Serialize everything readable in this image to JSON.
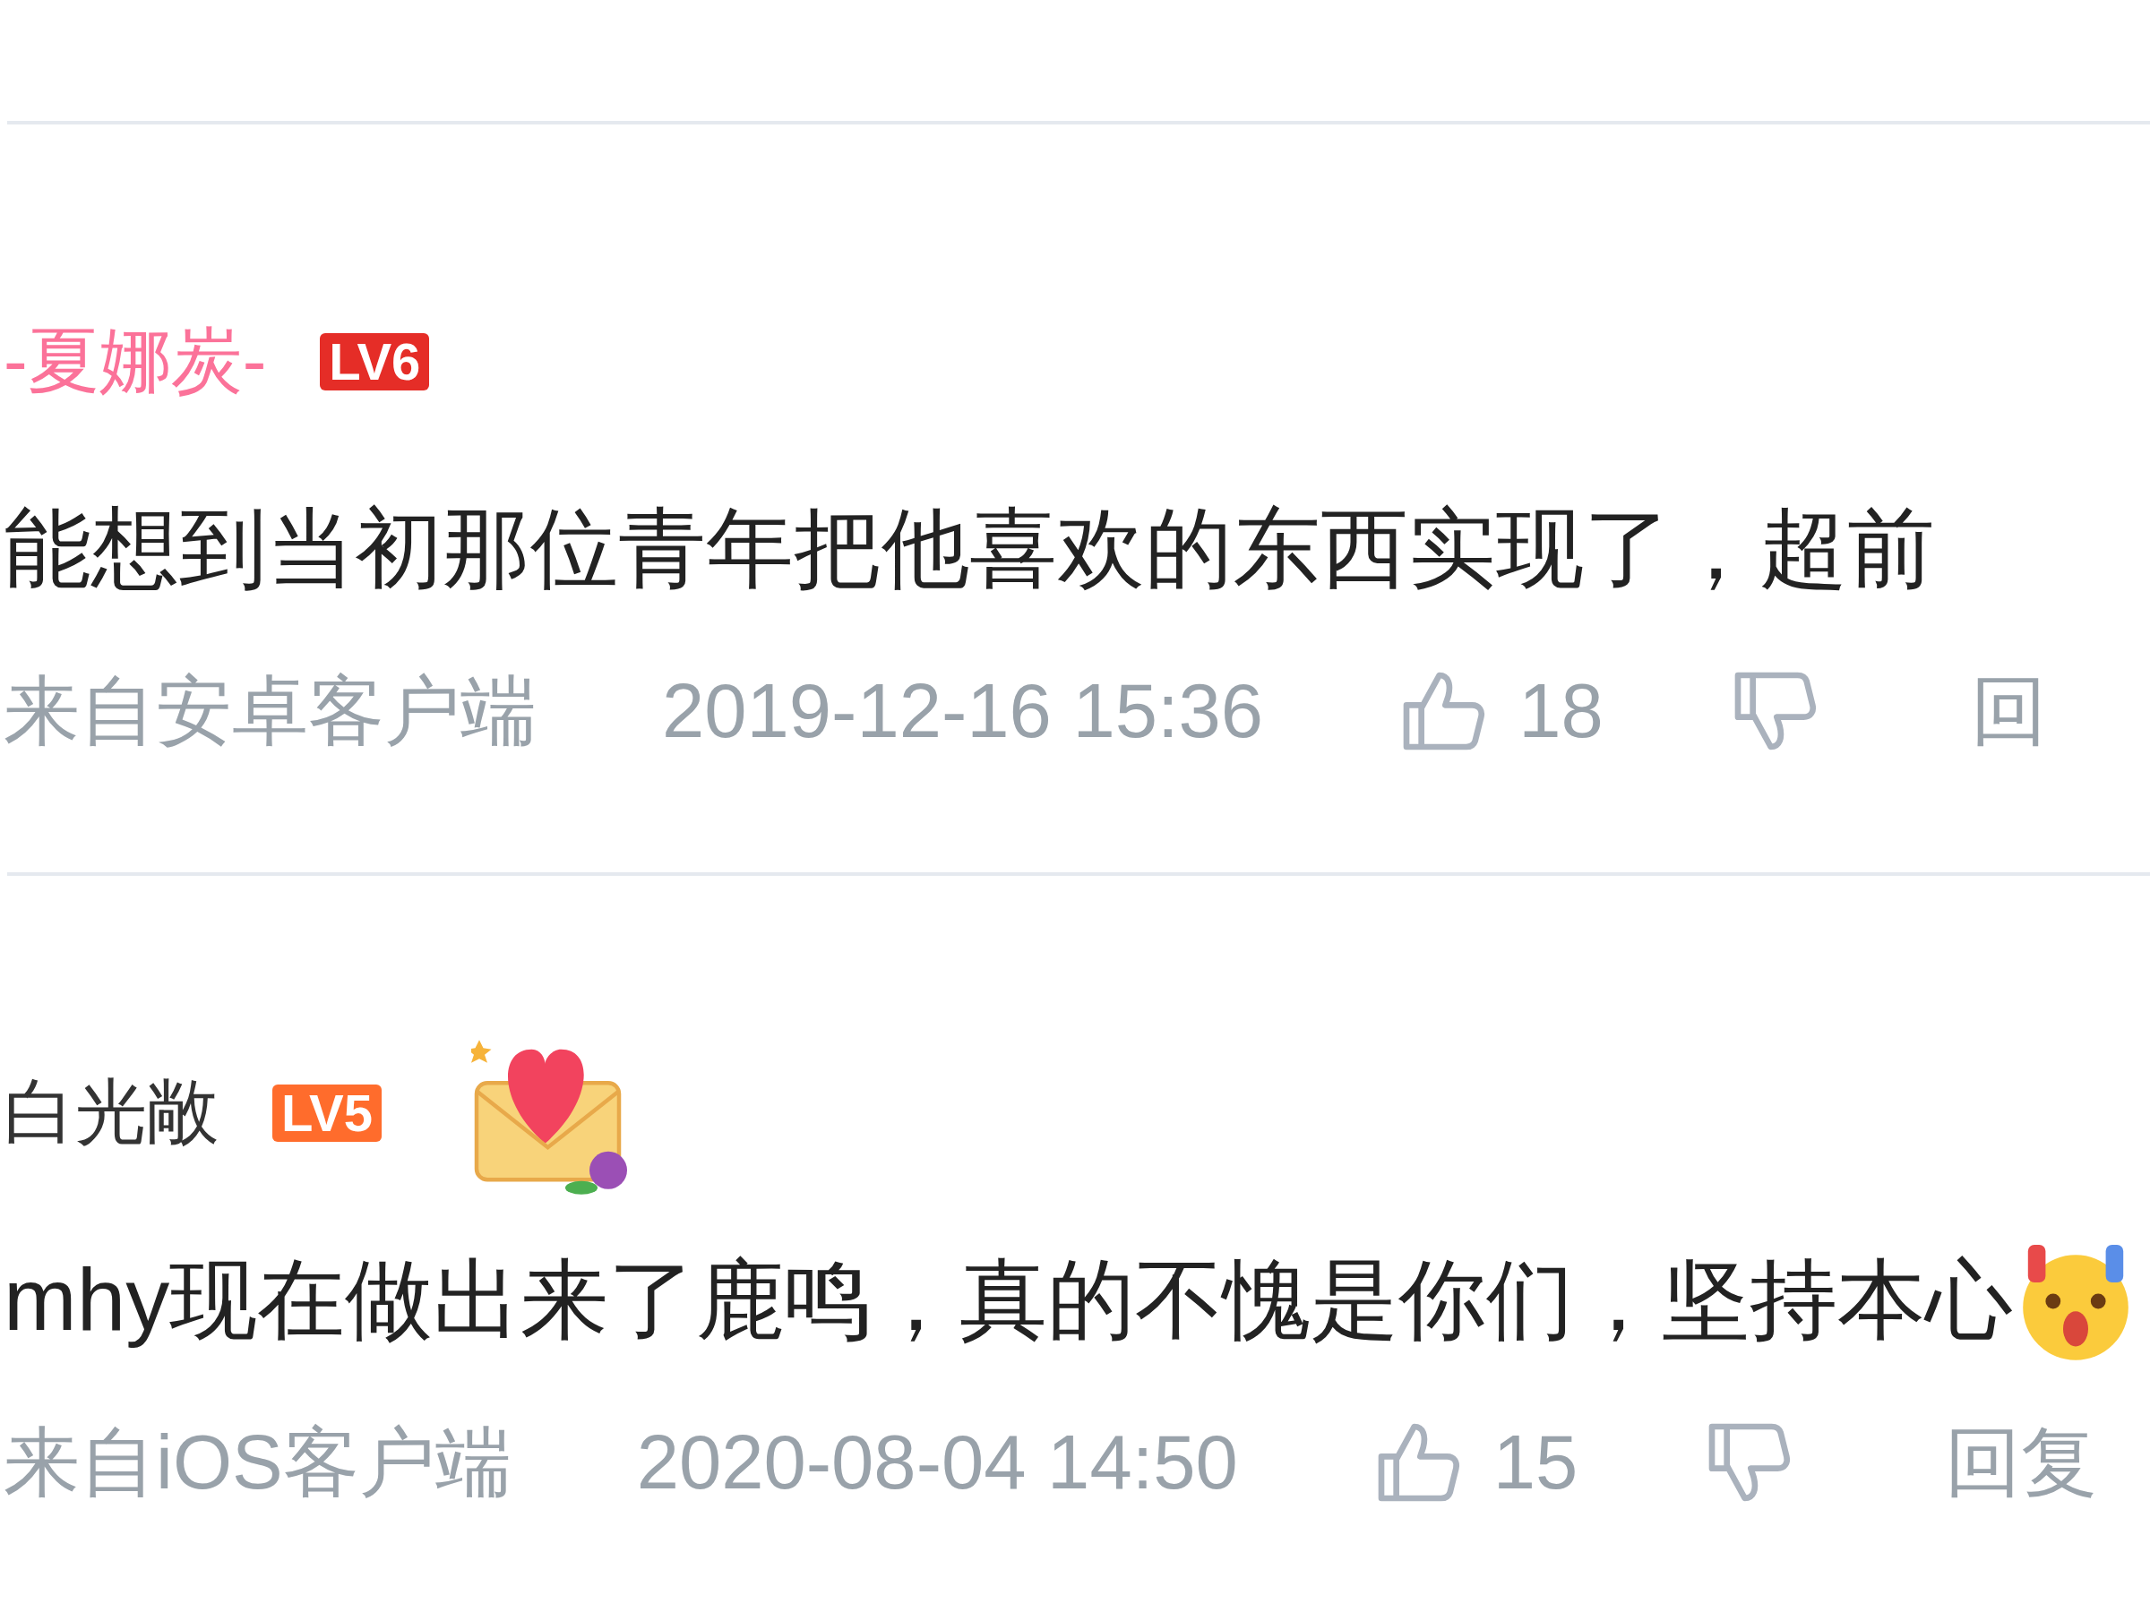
{
  "comments": [
    {
      "name": "-夏娜炭-",
      "vip": true,
      "level": "LV6",
      "color": "#e52d27",
      "sticker": false,
      "text": "能想到当初那位青年把他喜欢的东西实现了，超前",
      "end_emoji": false,
      "source": "来自安卓客户端",
      "time": "2019-12-16 15:36",
      "likes": "18",
      "reply": "回"
    },
    {
      "name": "白光敞",
      "vip": false,
      "level": "LV5",
      "color": "#ff6c2c",
      "sticker": true,
      "text": "mhy现在做出来了鹿鸣，真的不愧是你们，坚持本心",
      "end_emoji": true,
      "source": "来自iOS客户端",
      "time": "2020-08-04 14:50",
      "likes": "15",
      "reply": "回复"
    }
  ]
}
